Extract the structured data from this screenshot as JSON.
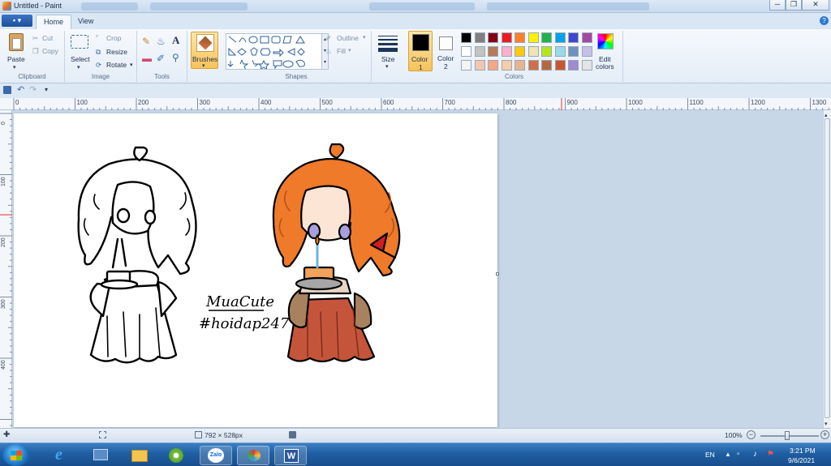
{
  "window": {
    "title": "Untitled - Paint"
  },
  "tabs": {
    "file": "▪ ▾",
    "home": "Home",
    "view": "View"
  },
  "clipboard": {
    "paste": "Paste",
    "cut": "Cut",
    "copy": "Copy",
    "label": "Clipboard"
  },
  "image": {
    "select": "Select",
    "crop": "Crop",
    "resize": "Resize",
    "rotate": "Rotate",
    "label": "Image"
  },
  "tools": {
    "label": "Tools"
  },
  "brushes": {
    "label": "Brushes"
  },
  "shapes": {
    "label": "Shapes",
    "outline": "Outline",
    "fill": "Fill"
  },
  "size": {
    "label": "Size"
  },
  "colors": {
    "color1_label": "Color",
    "color1_num": "1",
    "color2_label": "Color",
    "color2_num": "2",
    "edit_label": "Edit",
    "edit_label2": "colors",
    "label": "Colors",
    "color1": "#000000",
    "color2": "#ffffff",
    "palette_row1": [
      "#000000",
      "#7f7f7f",
      "#880015",
      "#ed1c24",
      "#ff7f27",
      "#fff200",
      "#22b14c",
      "#00a2e8",
      "#3f48cc",
      "#a349a4"
    ],
    "palette_row2": [
      "#ffffff",
      "#c3c3c3",
      "#b97a57",
      "#ffaec9",
      "#ffc90e",
      "#efe4b0",
      "#b5e61d",
      "#99d9ea",
      "#7092be",
      "#c8bfe7"
    ],
    "palette_row3": [
      "#f5f5f5",
      "#f3c6b0",
      "#f4a882",
      "#f8cda8",
      "#e8b48f",
      "#d0704a",
      "#b5683f",
      "#c9572e",
      "#a08ad0",
      "#e5e5e5"
    ]
  },
  "ruler": {
    "ticks": [
      "0",
      "100",
      "200",
      "300",
      "400",
      "500",
      "600",
      "700",
      "800",
      "900",
      "1000",
      "1100",
      "1200",
      "1300"
    ],
    "vticks": [
      "0",
      "100",
      "200",
      "300",
      "400"
    ]
  },
  "drawing": {
    "text_line1": "MuaCute",
    "text_line2": "#hoidap247"
  },
  "status": {
    "dimensions": "792 × 528px",
    "zoom": "100%"
  },
  "taskbar": {
    "lang": "EN",
    "time": "3:21 PM",
    "date": "9/6/2021",
    "zalo": "Zalo"
  }
}
